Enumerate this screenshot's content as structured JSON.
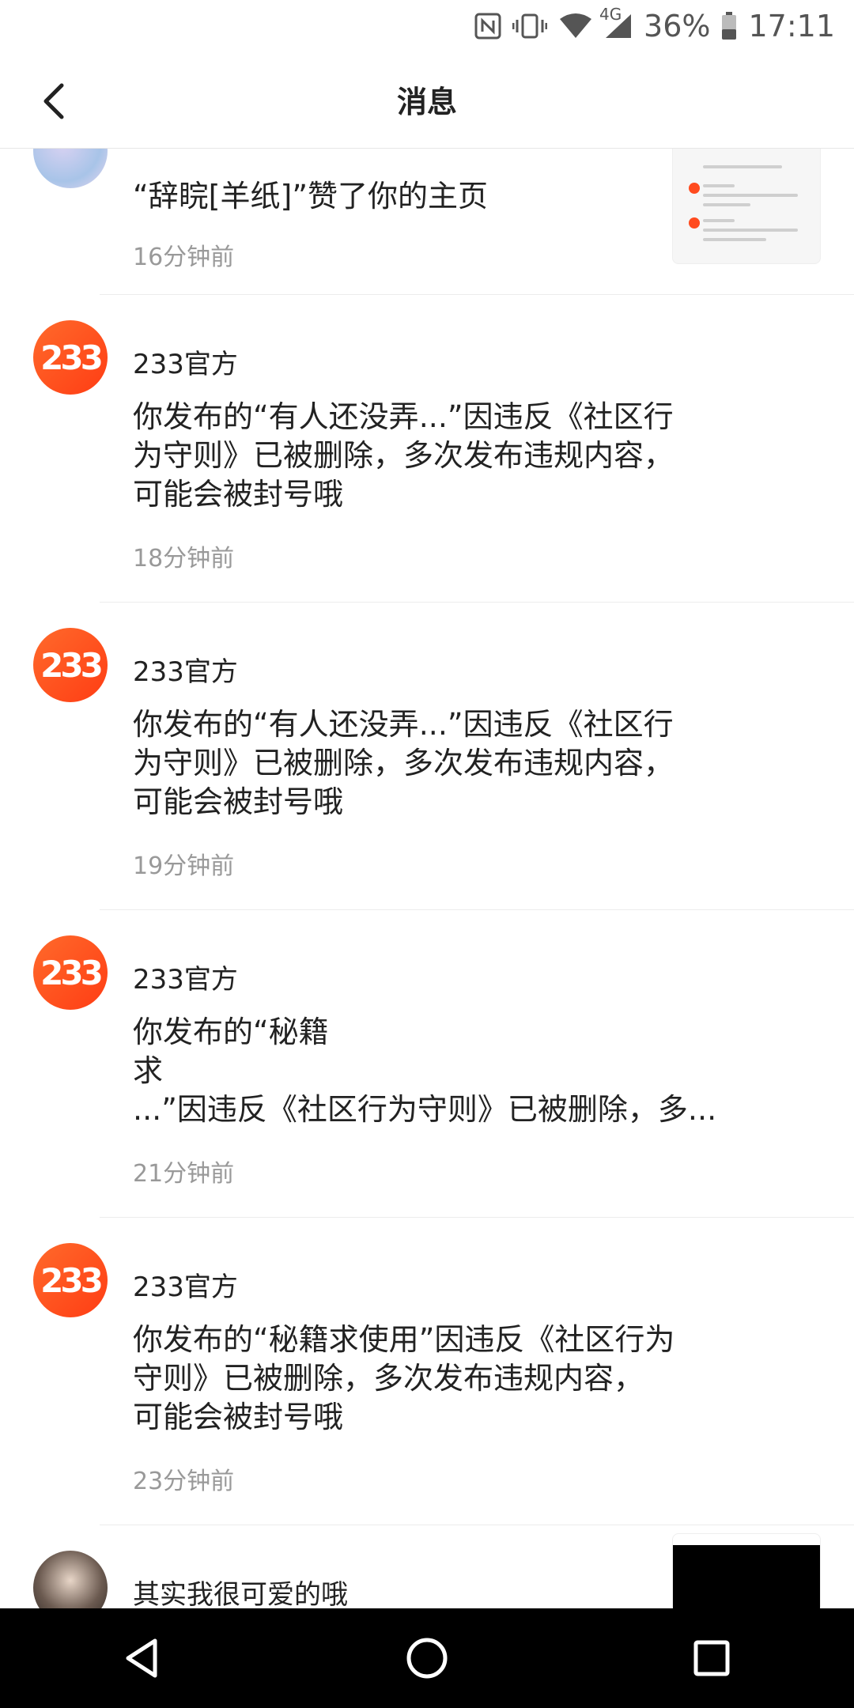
{
  "status_bar": {
    "network": "4G",
    "battery": "36%",
    "time": "17:11"
  },
  "header": {
    "title": "消息"
  },
  "messages": [
    {
      "name": "",
      "text": "“辞睆[羊纸]”赞了你的主页",
      "time": "16分钟前"
    },
    {
      "name": "233官方",
      "text": "你发布的“有人还没弄...”因违反《社区行\n为守则》已被删除，多次发布违规内容，\n可能会被封号哦",
      "time": "18分钟前"
    },
    {
      "name": "233官方",
      "text": "你发布的“有人还没弄...”因违反《社区行\n为守则》已被删除，多次发布违规内容，\n可能会被封号哦",
      "time": "19分钟前"
    },
    {
      "name": "233官方",
      "text": "你发布的“秘籍\n求\n...”因违反《社区行为守则》已被删除，多...",
      "time": "21分钟前"
    },
    {
      "name": "233官方",
      "text": "你发布的“秘籍求使用”因违反《社区行为\n守则》已被删除，多次发布违规内容，\n可能会被封号哦",
      "time": "23分钟前"
    },
    {
      "name": "其实我很可爱的哦",
      "text": "",
      "time": ""
    }
  ],
  "avatar_label": "233",
  "colors": {
    "accent": "#ff4b1f",
    "time_text": "#999999",
    "nav_bg": "#000000"
  }
}
